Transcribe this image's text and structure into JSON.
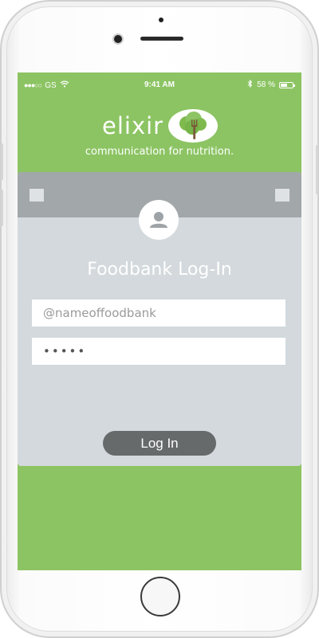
{
  "status_bar": {
    "carrier": "GS",
    "time": "9:41 AM",
    "battery": "58 %",
    "battery_level": 0.58
  },
  "brand": {
    "name": "elixir",
    "tagline": "communication for nutrition."
  },
  "login": {
    "title": "Foodbank Log-In",
    "username_placeholder": "@nameoffoodbank",
    "password_value": "•••••",
    "button_label": "Log In"
  },
  "colors": {
    "screen_background": "#8cc463",
    "card_background": "#d3d9dc",
    "card_header": "#a2a7aa",
    "button_background": "#666a6b",
    "logo_tree": "#7fba4f",
    "logo_fork": "#7a5a3a"
  },
  "icons": {
    "logo": "tree-fork-icon",
    "avatar": "user-icon",
    "wifi": "wifi-icon",
    "bluetooth": "bluetooth-icon",
    "battery": "battery-icon"
  }
}
